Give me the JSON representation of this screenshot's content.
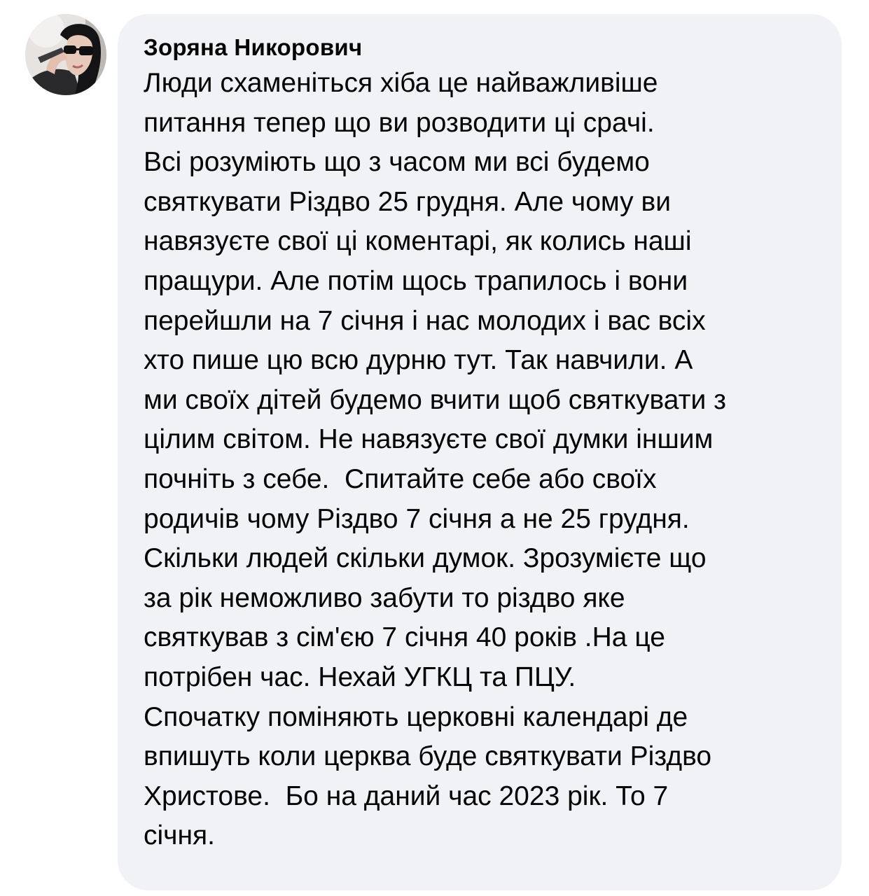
{
  "comment": {
    "author": {
      "name": "Зоряна Никорович",
      "avatar_icon": "profile-photo-avatar"
    },
    "text_lines": [
      "Люди схаменіться хіба це найважливіше",
      "питання тепер що ви розводити ці срачі.",
      "Всі розуміють що з часом ми всі будемо",
      "святкувати Різдво 25 грудня. Але чому ви",
      "навязуєте свої ці коментарі, як колись наші",
      "пращури. Але потім щось трапилось і вони",
      "перейшли на 7 січня і нас молодих і вас всіх",
      "хто пише цю всю дурню тут. Так навчили. А",
      "ми своїх дітей будемо вчити щоб святкувати з",
      "цілим світом. Не навязуєте свої думки іншим",
      "почніть з себе.  Спитайте себе або своїх",
      "родичів чому Різдво 7 січня а не 25 грудня.",
      "Скільки людей скільки думок. Зрозумієте що",
      "за рік неможливо забути то різдво яке",
      "святкував з сім'єю 7 січня 40 років .На це",
      "потрібен час. Нехай УГКЦ та ПЦУ.",
      "Спочатку поміняють церковні календарі де",
      "впишуть коли церква буде святкувати Різдво",
      "Христове.  Бо на даний час 2023 рік. То 7",
      "січня."
    ]
  },
  "colors": {
    "bubble_background": "#f0f2f5",
    "text": "#050505",
    "page_background": "#ffffff"
  }
}
